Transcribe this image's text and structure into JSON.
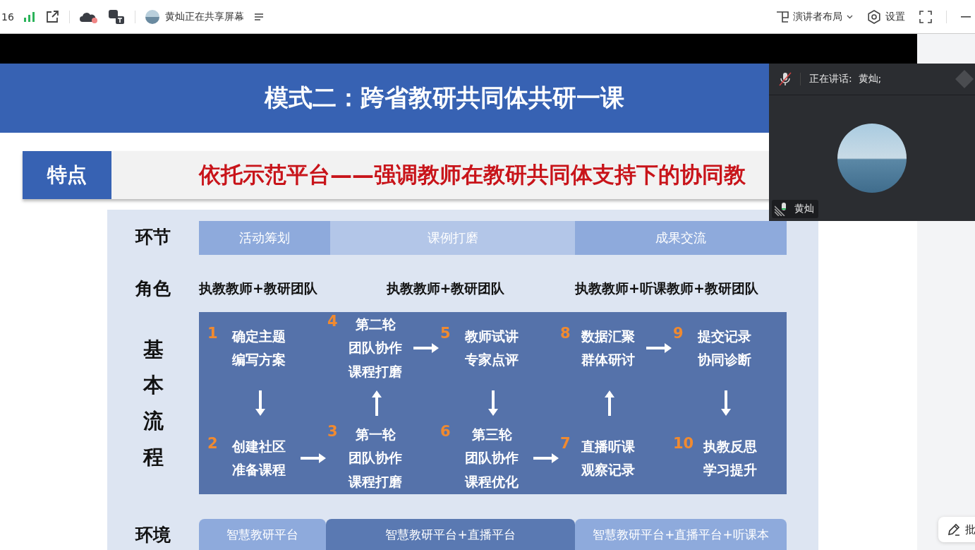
{
  "toolbar": {
    "time": "16",
    "sharing_label": "黄灿正在共享屏幕",
    "layout_button": "演讲者布局",
    "settings_button": "设置"
  },
  "slide": {
    "title": "模式二：跨省教研共同体共研一课",
    "feature_tag": "特点",
    "feature_text": "依托示范平台——强调教师在教研共同体支持下的协同教",
    "row_labels": [
      "环节",
      "角色",
      "基本流程",
      "环境"
    ],
    "phases": [
      {
        "label": "活动筹划",
        "color": "#8eaadc"
      },
      {
        "label": "课例打磨",
        "color": "#b3c6e8"
      },
      {
        "label": "成果交流",
        "color": "#8eaadc"
      }
    ],
    "roles": [
      "执教教师+教研团队",
      "执教教师+教研团队",
      "执教教师+听课教师+教研团队"
    ],
    "columns": [
      {
        "top": {
          "number": "1",
          "lines": [
            "确定主题",
            "编写方案"
          ]
        },
        "bottom": {
          "number": "2",
          "lines": [
            "创建社区",
            "准备课程"
          ]
        }
      },
      {
        "top": {
          "number": "4",
          "lines": [
            "第二轮",
            "团队协作",
            "课程打磨"
          ]
        },
        "bottom": {
          "number": "3",
          "lines": [
            "第一轮",
            "团队协作",
            "课程打磨"
          ]
        }
      },
      {
        "top": {
          "number": "5",
          "lines": [
            "教师试讲",
            "专家点评"
          ]
        },
        "bottom": {
          "number": "6",
          "lines": [
            "第三轮",
            "团队协作",
            "课程优化"
          ]
        }
      },
      {
        "top": {
          "number": "8",
          "lines": [
            "数据汇聚",
            "群体研讨"
          ]
        },
        "bottom": {
          "number": "7",
          "lines": [
            "直播听课",
            "观察记录"
          ]
        }
      },
      {
        "top": {
          "number": "9",
          "lines": [
            "提交记录",
            "协同诊断"
          ]
        },
        "bottom": {
          "number": "10",
          "lines": [
            "执教反思",
            "学习提升"
          ]
        }
      }
    ],
    "environments": [
      {
        "label": "智慧教研平台",
        "color": "#8eaadc"
      },
      {
        "label": "智慧教研平台+直播平台",
        "color": "#5a79b2"
      },
      {
        "label": "智慧教研平台+直播平台+听课本",
        "color": "#8eaadc"
      }
    ]
  },
  "speaker_panel": {
    "speaking_label": "正在讲话:  黄灿;",
    "name_tag": "黄灿"
  },
  "annotate_button": "批"
}
